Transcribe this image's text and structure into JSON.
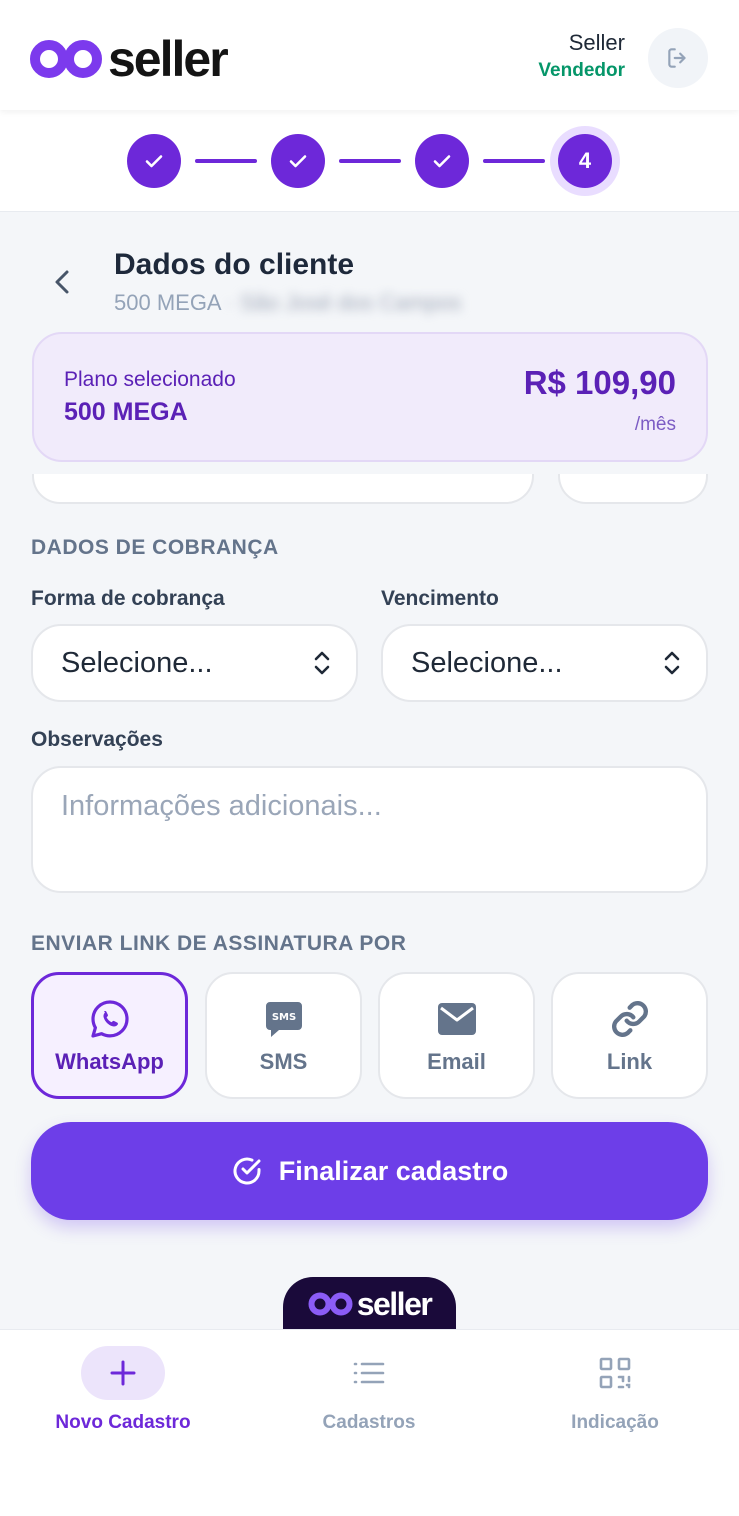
{
  "header": {
    "brand": "seller",
    "user_name": "Seller",
    "user_role": "Vendedor",
    "logout_icon": "logout-icon"
  },
  "stepper": {
    "steps": [
      {
        "status": "done"
      },
      {
        "status": "done"
      },
      {
        "status": "done"
      },
      {
        "status": "current",
        "label": "4"
      }
    ]
  },
  "page": {
    "title": "Dados do cliente",
    "subtitle_plan": "500 MEGA",
    "subtitle_separator": "·",
    "subtitle_location": "São José dos Campos"
  },
  "plan": {
    "label": "Plano selecionado",
    "name": "500 MEGA",
    "price": "R$ 109,90",
    "period": "/mês"
  },
  "billing": {
    "section_title": "DADOS DE COBRANÇA",
    "method_label": "Forma de cobrança",
    "method_value": "Selecione...",
    "due_label": "Vencimento",
    "due_value": "Selecione..."
  },
  "notes": {
    "label": "Observações",
    "placeholder": "Informações adicionais..."
  },
  "send_link": {
    "section_title": "ENVIAR LINK DE ASSINATURA POR",
    "options": [
      {
        "label": "WhatsApp",
        "icon": "whatsapp-icon",
        "selected": true
      },
      {
        "label": "SMS",
        "icon": "sms-icon",
        "selected": false
      },
      {
        "label": "Email",
        "icon": "email-icon",
        "selected": false
      },
      {
        "label": "Link",
        "icon": "link-icon",
        "selected": false
      }
    ]
  },
  "finish_button": {
    "label": "Finalizar cadastro",
    "icon": "check-circle-icon"
  },
  "footer": {
    "brand": "seller"
  },
  "bottom_nav": {
    "items": [
      {
        "label": "Novo Cadastro",
        "icon": "plus-icon",
        "active": true
      },
      {
        "label": "Cadastros",
        "icon": "list-icon",
        "active": false
      },
      {
        "label": "Indicação",
        "icon": "qr-code-icon",
        "active": false
      }
    ]
  },
  "colors": {
    "primary": "#6d28d9",
    "button": "#6d3ee8",
    "success": "#059669",
    "background": "#f4f6f9"
  }
}
